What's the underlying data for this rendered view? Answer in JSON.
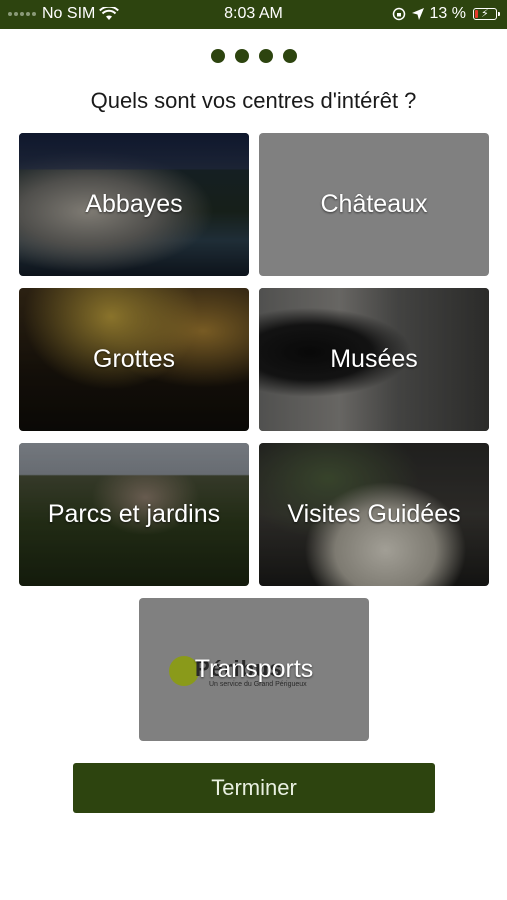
{
  "status_bar": {
    "carrier": "No SIM",
    "time": "8:03 AM",
    "battery_percent": "13 %",
    "battery_level": 0.13,
    "icons": [
      "wifi-icon",
      "rotation-lock-icon",
      "location-arrow-icon",
      "battery-charging-icon"
    ]
  },
  "pager": {
    "total_pages": 4,
    "current_page": 4
  },
  "title": "Quels sont vos centres d'intérêt ?",
  "tiles": [
    {
      "label": "Abbayes"
    },
    {
      "label": "Châteaux"
    },
    {
      "label": "Grottes"
    },
    {
      "label": "Musées"
    },
    {
      "label": "Parcs et jardins"
    },
    {
      "label": "Visites Guidées"
    },
    {
      "label": "Transports",
      "logo_text": "Péribus",
      "logo_subtext": "Un service du Grand Périgueux"
    }
  ],
  "finish_button": {
    "label": "Terminer"
  },
  "colors": {
    "accent": "#2d440f",
    "tile_grey": "#808080"
  }
}
